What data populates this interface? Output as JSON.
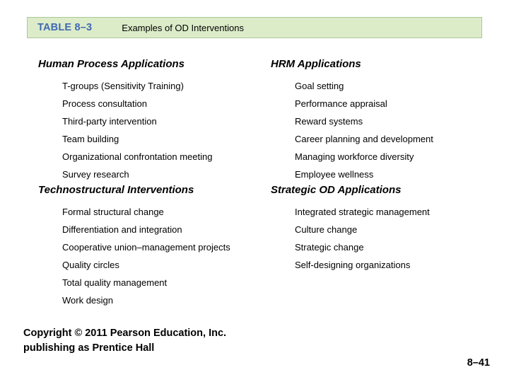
{
  "header": {
    "table_label": "TABLE 8–3",
    "caption": "Examples of OD Interventions",
    "background_color": "#dcecc9",
    "border_color": "#aac894",
    "label_color": "#4169b4"
  },
  "sections": [
    {
      "left": {
        "heading": "Human Process Applications",
        "items": [
          "T-groups (Sensitivity Training)",
          "Process consultation",
          "Third-party intervention",
          "Team building",
          "Organizational confrontation meeting",
          "Survey research"
        ]
      },
      "right": {
        "heading": "HRM Applications",
        "items": [
          "Goal setting",
          "Performance appraisal",
          "Reward systems",
          "Career planning and development",
          "Managing workforce diversity",
          "Employee wellness"
        ]
      }
    },
    {
      "left": {
        "heading": "Technostructural Interventions",
        "items": [
          "Formal structural change",
          "Differentiation and integration",
          "Cooperative union–management projects",
          "Quality circles",
          "Total quality management",
          "Work design"
        ]
      },
      "right": {
        "heading": "Strategic OD Applications",
        "items": [
          "Integrated strategic management",
          "Culture change",
          "Strategic change",
          "Self-designing organizations"
        ]
      }
    }
  ],
  "footer": {
    "copyright": "Copyright © 2011 Pearson Education, Inc. publishing as Prentice Hall",
    "page_number": "8–41"
  }
}
